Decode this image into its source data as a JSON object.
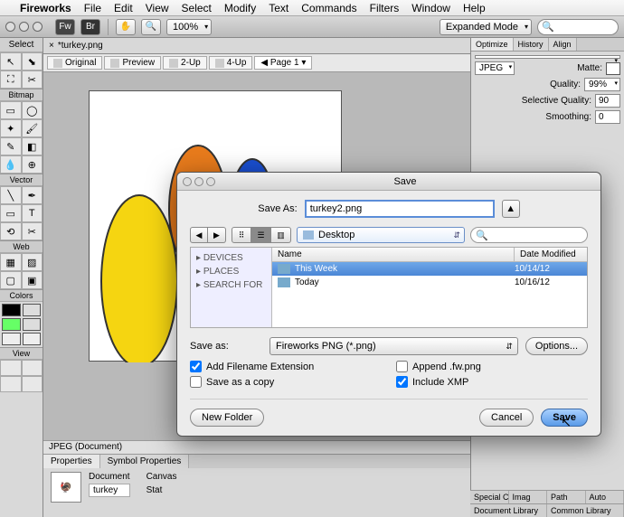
{
  "menubar": {
    "apple": "",
    "app": "Fireworks",
    "items": [
      "File",
      "Edit",
      "View",
      "Select",
      "Modify",
      "Text",
      "Commands",
      "Filters",
      "Window",
      "Help"
    ]
  },
  "toolbar": {
    "fw": "Fw",
    "br": "Br",
    "zoom": "100%",
    "mode": "Expanded Mode"
  },
  "left": {
    "select": "Select",
    "bitmap": "Bitmap",
    "vector": "Vector",
    "web": "Web",
    "colors": "Colors",
    "view": "View"
  },
  "doc": {
    "tab_title": "*turkey.png",
    "original": "Original",
    "preview": "Preview",
    "twoup": "2-Up",
    "fourup": "4-Up",
    "page": "Page 1"
  },
  "right": {
    "tabs": [
      "Optimize",
      "History",
      "Align"
    ],
    "format": "JPEG",
    "matte": "Matte:",
    "quality_l": "Quality:",
    "quality_v": "99%",
    "selq_l": "Selective Quality:",
    "selq_v": "90",
    "smooth_l": "Smoothing:",
    "smooth_v": "0"
  },
  "status": "JPEG (Document)",
  "props": {
    "tabs": [
      "Properties",
      "Symbol Properties"
    ],
    "doc": "Document",
    "name": "turkey",
    "canvas": "Canvas",
    "state": "Stat"
  },
  "br_tabs": {
    "r1": [
      "Special Characters",
      "Imag",
      "Path",
      "Auto"
    ],
    "r2": [
      "Document Library",
      "Common Library"
    ]
  },
  "dialog": {
    "title": "Save",
    "saveas_l": "Save As:",
    "filename": "turkey2.png",
    "location": "Desktop",
    "sidebar": [
      "DEVICES",
      "PLACES",
      "SEARCH FOR"
    ],
    "cols": [
      "Name",
      "Date Modified"
    ],
    "rows": [
      {
        "name": "This Week",
        "date": "10/14/12",
        "sel": true
      },
      {
        "name": "Today",
        "date": "10/16/12",
        "sel": false
      }
    ],
    "fmt_l": "Save as:",
    "fmt": "Fireworks PNG (*.png)",
    "options": "Options...",
    "chk_ext": "Add Filename Extension",
    "chk_fw": "Append .fw.png",
    "chk_copy": "Save as a copy",
    "chk_xmp": "Include XMP",
    "newfolder": "New Folder",
    "cancel": "Cancel",
    "save": "Save"
  }
}
